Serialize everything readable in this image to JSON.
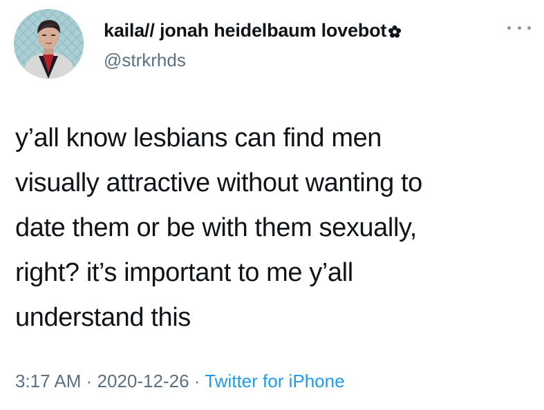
{
  "tweet": {
    "author": {
      "display_name": "kaila// jonah heidelbaum lovebot",
      "handle": "@strkrhds",
      "avatar": "profile-avatar",
      "name_emoji_icon": "flower-icon"
    },
    "more_icon": "more-options-icon",
    "text_lines": [
      "y’all know lesbians can find men",
      "visually attractive without wanting to",
      "date them or be with them sexually,",
      "right? it’s important to me y’all",
      "understand this"
    ],
    "time": "3:17 AM",
    "separator": "·",
    "date": "2020-12-26",
    "source": "Twitter for iPhone"
  },
  "colors": {
    "text": "#0f1419",
    "secondary": "#5b7083",
    "link": "#1d9bf0",
    "background": "#ffffff"
  }
}
